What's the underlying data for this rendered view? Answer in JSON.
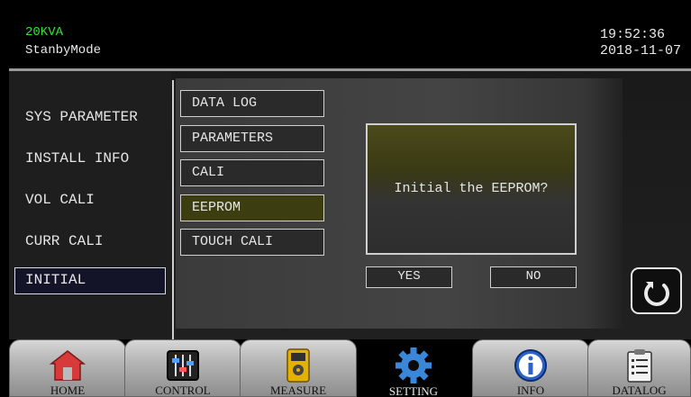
{
  "header": {
    "model": "20KVA",
    "mode": "StanbyMode",
    "time": "19:52:36",
    "date": "2018-11-07"
  },
  "left_menu": {
    "items": [
      {
        "label": "SYS PARAMETER"
      },
      {
        "label": "INSTALL INFO"
      },
      {
        "label": "VOL CALI"
      },
      {
        "label": "CURR CALI"
      },
      {
        "label": "INITIAL",
        "selected": true
      }
    ]
  },
  "sub_menu": {
    "items": [
      {
        "label": "DATA LOG"
      },
      {
        "label": "PARAMETERS"
      },
      {
        "label": "CALI"
      },
      {
        "label": "EEPROM",
        "selected": true
      },
      {
        "label": "TOUCH CALI"
      }
    ]
  },
  "dialog": {
    "message": "Initial the EEPROM?",
    "yes": "YES",
    "no": "NO"
  },
  "tabs": [
    {
      "label": "HOME",
      "icon": "home-icon"
    },
    {
      "label": "CONTROL",
      "icon": "control-sliders-icon"
    },
    {
      "label": "MEASURE",
      "icon": "multimeter-icon"
    },
    {
      "label": "SETTING",
      "icon": "gear-icon",
      "active": true
    },
    {
      "label": "INFO",
      "icon": "info-icon"
    },
    {
      "label": "DATALOG",
      "icon": "clipboard-list-icon"
    }
  ],
  "colors": {
    "model_text": "#33e03a",
    "selected_left": "#141428",
    "selected_sub": "#3d3d12",
    "dialog_top": "#4b4a1a"
  }
}
